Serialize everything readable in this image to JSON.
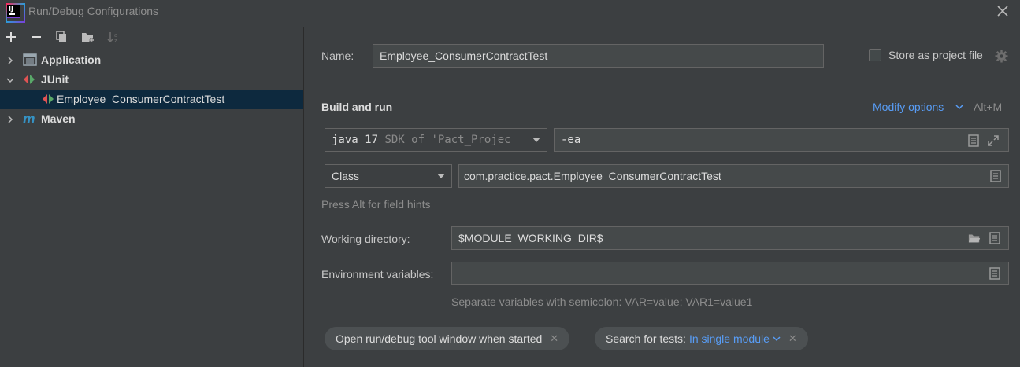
{
  "window": {
    "title": "Run/Debug Configurations"
  },
  "tree": {
    "items": [
      {
        "label": "Application"
      },
      {
        "label": "JUnit"
      },
      {
        "label": "Employee_ConsumerContractTest"
      },
      {
        "label": "Maven"
      }
    ]
  },
  "form": {
    "name_label": "Name:",
    "name_value": "Employee_ConsumerContractTest",
    "store_label": "Store as project file",
    "section_title": "Build and run",
    "modify_options": "Modify options",
    "modify_shortcut": "Alt+M",
    "jre_main": "java 17",
    "jre_dim": "SDK of 'Pact_Projec",
    "vm_options": "-ea",
    "test_kind": "Class",
    "class_value": "com.practice.pact.Employee_ConsumerContractTest",
    "field_hint": "Press Alt for field hints",
    "working_dir_label": "Working directory:",
    "working_dir_value": "$MODULE_WORKING_DIR$",
    "env_label": "Environment variables:",
    "env_value": "",
    "env_hint": "Separate variables with semicolon: VAR=value; VAR1=value1",
    "chip_open_window": "Open run/debug tool window when started",
    "chip_search_prefix": "Search for tests:",
    "chip_search_value": "In single module"
  },
  "colors": {
    "accent_link": "#589df6",
    "selection": "#0d293e"
  }
}
